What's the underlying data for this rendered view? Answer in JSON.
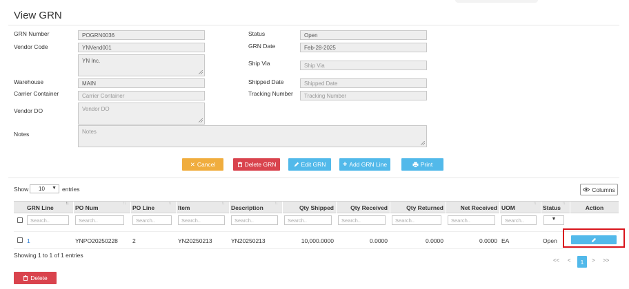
{
  "page": {
    "title": "View GRN"
  },
  "form": {
    "grn_number": {
      "label": "GRN Number",
      "value": "POGRN0036"
    },
    "vendor_code": {
      "label": "Vendor Code",
      "value": "YNVend001"
    },
    "vendor_name": {
      "value": "YN Inc."
    },
    "warehouse": {
      "label": "Warehouse",
      "value": "MAIN"
    },
    "carrier_container": {
      "label": "Carrier Container",
      "placeholder": "Carrier Container"
    },
    "vendor_do": {
      "label": "Vendor DO",
      "placeholder": "Vendor DO"
    },
    "notes": {
      "label": "Notes",
      "placeholder": "Notes"
    },
    "status": {
      "label": "Status",
      "value": "Open"
    },
    "grn_date": {
      "label": "GRN Date",
      "value": "Feb-28-2025"
    },
    "ship_via": {
      "label": "Ship Via",
      "placeholder": "Ship Via"
    },
    "shipped_date": {
      "label": "Shipped Date",
      "placeholder": "Shipped Date"
    },
    "tracking_number": {
      "label": "Tracking Number",
      "placeholder": "Tracking Number"
    }
  },
  "actions": {
    "cancel": "Cancel",
    "delete_grn": "Delete GRN",
    "edit_grn": "Edit GRN",
    "add_grn_line": "Add GRN Line",
    "print": "Print"
  },
  "table_controls": {
    "show_label": "Show",
    "page_size": "10",
    "entries_label": "entries",
    "columns_button": "Columns"
  },
  "table": {
    "headers": [
      "GRN Line",
      "PO Num",
      "PO Line",
      "Item",
      "Description",
      "Qty Shipped",
      "Qty Received",
      "Qty Returned",
      "Net Received",
      "UOM",
      "Status",
      "Action"
    ],
    "search_placeholder": "Search..",
    "rows": [
      {
        "grn_line": "1",
        "po_num": "YNPO20250228",
        "po_line": "2",
        "item": "YN20250213",
        "description": "YN20250213",
        "qty_shipped": "10,000.0000",
        "qty_received": "0.0000",
        "qty_returned": "0.0000",
        "net_received": "0.0000",
        "uom": "EA",
        "status": "Open"
      }
    ]
  },
  "footer": {
    "showing": "Showing 1 to 1 of 1 entries",
    "pager": {
      "first": "<<",
      "prev": "<",
      "current": "1",
      "next": ">",
      "last": ">>"
    },
    "delete_button": "Delete"
  },
  "icons": {
    "cancel": "x-icon",
    "delete": "trash-icon",
    "edit": "pencil-icon",
    "add": "plus-icon",
    "print": "printer-icon",
    "columns": "eye-icon"
  },
  "colors": {
    "cancel": "#f0ad3e",
    "danger": "#d9434d",
    "primary": "#52b9ea",
    "highlight": "#d9131b"
  }
}
